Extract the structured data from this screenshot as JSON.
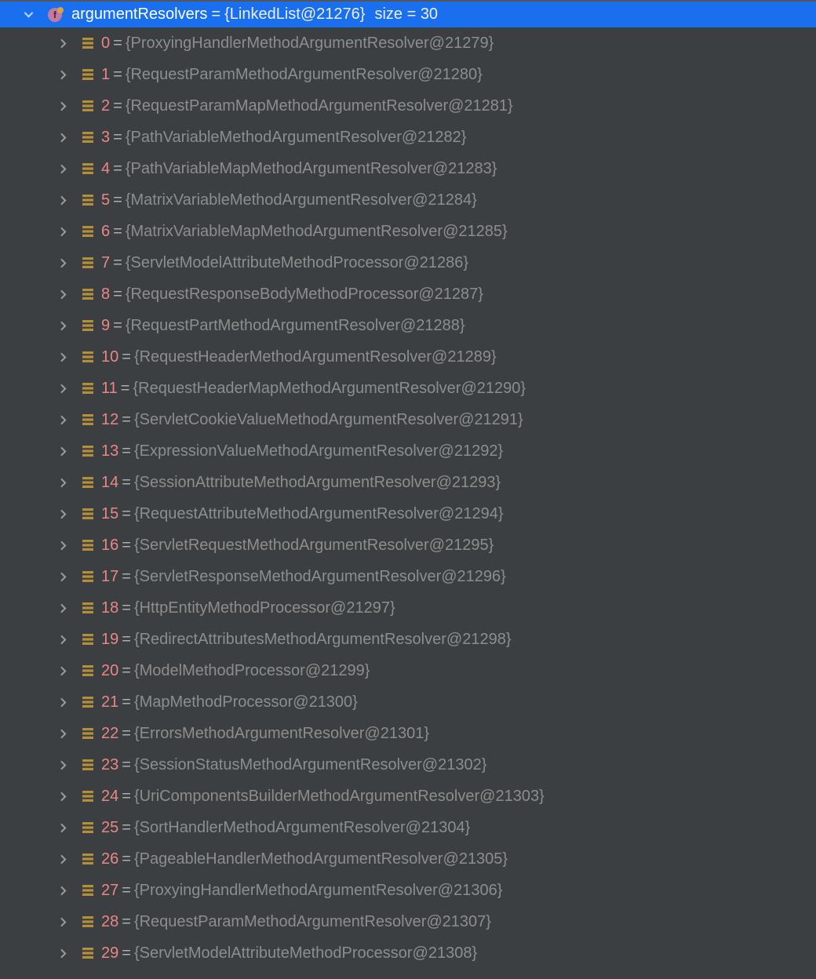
{
  "header": {
    "name": "argumentResolvers",
    "eq": "=",
    "value": "{LinkedList@21276}",
    "size_label": "size = 30"
  },
  "items": [
    {
      "index": "0",
      "eq": " = ",
      "value": "{ProxyingHandlerMethodArgumentResolver@21279}"
    },
    {
      "index": "1",
      "eq": " = ",
      "value": "{RequestParamMethodArgumentResolver@21280}"
    },
    {
      "index": "2",
      "eq": " = ",
      "value": "{RequestParamMapMethodArgumentResolver@21281}"
    },
    {
      "index": "3",
      "eq": " = ",
      "value": "{PathVariableMethodArgumentResolver@21282}"
    },
    {
      "index": "4",
      "eq": " = ",
      "value": "{PathVariableMapMethodArgumentResolver@21283}"
    },
    {
      "index": "5",
      "eq": " = ",
      "value": "{MatrixVariableMethodArgumentResolver@21284}"
    },
    {
      "index": "6",
      "eq": " = ",
      "value": "{MatrixVariableMapMethodArgumentResolver@21285}"
    },
    {
      "index": "7",
      "eq": " = ",
      "value": "{ServletModelAttributeMethodProcessor@21286}"
    },
    {
      "index": "8",
      "eq": " = ",
      "value": "{RequestResponseBodyMethodProcessor@21287}"
    },
    {
      "index": "9",
      "eq": " = ",
      "value": "{RequestPartMethodArgumentResolver@21288}"
    },
    {
      "index": "10",
      "eq": " = ",
      "value": "{RequestHeaderMethodArgumentResolver@21289}"
    },
    {
      "index": "11",
      "eq": " = ",
      "value": "{RequestHeaderMapMethodArgumentResolver@21290}"
    },
    {
      "index": "12",
      "eq": " = ",
      "value": "{ServletCookieValueMethodArgumentResolver@21291}"
    },
    {
      "index": "13",
      "eq": " = ",
      "value": "{ExpressionValueMethodArgumentResolver@21292}"
    },
    {
      "index": "14",
      "eq": " = ",
      "value": "{SessionAttributeMethodArgumentResolver@21293}"
    },
    {
      "index": "15",
      "eq": " = ",
      "value": "{RequestAttributeMethodArgumentResolver@21294}"
    },
    {
      "index": "16",
      "eq": " = ",
      "value": "{ServletRequestMethodArgumentResolver@21295}"
    },
    {
      "index": "17",
      "eq": " = ",
      "value": "{ServletResponseMethodArgumentResolver@21296}"
    },
    {
      "index": "18",
      "eq": " = ",
      "value": "{HttpEntityMethodProcessor@21297}"
    },
    {
      "index": "19",
      "eq": " = ",
      "value": "{RedirectAttributesMethodArgumentResolver@21298}"
    },
    {
      "index": "20",
      "eq": " = ",
      "value": "{ModelMethodProcessor@21299}"
    },
    {
      "index": "21",
      "eq": " = ",
      "value": "{MapMethodProcessor@21300}"
    },
    {
      "index": "22",
      "eq": " = ",
      "value": "{ErrorsMethodArgumentResolver@21301}"
    },
    {
      "index": "23",
      "eq": " = ",
      "value": "{SessionStatusMethodArgumentResolver@21302}"
    },
    {
      "index": "24",
      "eq": " = ",
      "value": "{UriComponentsBuilderMethodArgumentResolver@21303}"
    },
    {
      "index": "25",
      "eq": " = ",
      "value": "{SortHandlerMethodArgumentResolver@21304}"
    },
    {
      "index": "26",
      "eq": " = ",
      "value": "{PageableHandlerMethodArgumentResolver@21305}"
    },
    {
      "index": "27",
      "eq": " = ",
      "value": "{ProxyingHandlerMethodArgumentResolver@21306}"
    },
    {
      "index": "28",
      "eq": " = ",
      "value": "{RequestParamMethodArgumentResolver@21307}"
    },
    {
      "index": "29",
      "eq": " = ",
      "value": "{ServletModelAttributeMethodProcessor@21308}"
    }
  ]
}
